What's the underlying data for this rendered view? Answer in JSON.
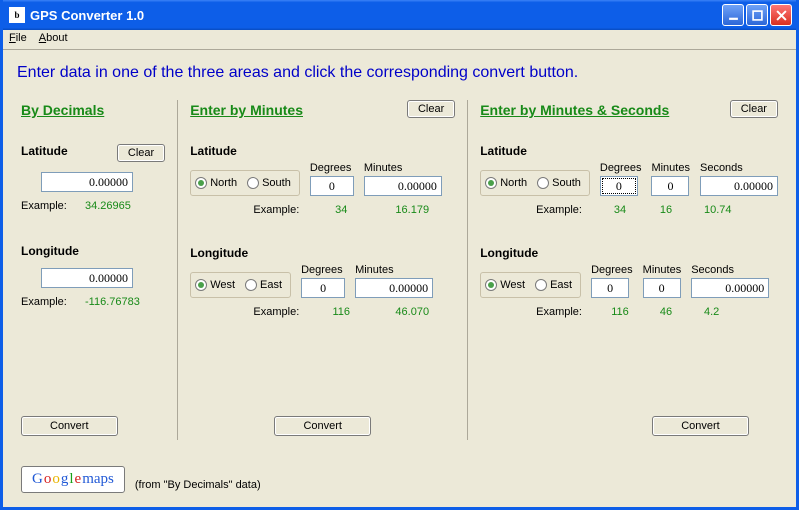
{
  "window": {
    "title": "GPS Converter 1.0"
  },
  "menu": {
    "file": "File",
    "about": "About"
  },
  "instruction": "Enter data in one of the three areas and click the corresponding convert button.",
  "common": {
    "latitude": "Latitude",
    "longitude": "Longitude",
    "example": "Example:",
    "degrees": "Degrees",
    "minutes": "Minutes",
    "seconds": "Seconds",
    "north": "North",
    "south": "South",
    "west": "West",
    "east": "East",
    "clear": "Clear",
    "convert": "Convert"
  },
  "decimals": {
    "title": "By Decimals",
    "lat_value": "0.00000",
    "lat_example": "34.26965",
    "lon_value": "0.00000",
    "lon_example": "-116.76783"
  },
  "minutes": {
    "title": "Enter by Minutes",
    "lat": {
      "deg": "0",
      "min": "0.00000",
      "ex_deg": "34",
      "ex_min": "16.179"
    },
    "lon": {
      "deg": "0",
      "min": "0.00000",
      "ex_deg": "116",
      "ex_min": "46.070"
    }
  },
  "minsec": {
    "title": "Enter by Minutes & Seconds",
    "lat": {
      "deg": "0",
      "min": "0",
      "sec": "0.00000",
      "ex_deg": "34",
      "ex_min": "16",
      "ex_sec": "10.74"
    },
    "lon": {
      "deg": "0",
      "min": "0",
      "sec": "0.00000",
      "ex_deg": "116",
      "ex_min": "46",
      "ex_sec": "4.2"
    }
  },
  "footer": {
    "google": {
      "g1": "G",
      "g2": "o",
      "g3": "o",
      "g4": "g",
      "g5": "l",
      "g6": "e",
      "maps": " maps"
    },
    "note": "(from \"By Decimals\" data)"
  }
}
